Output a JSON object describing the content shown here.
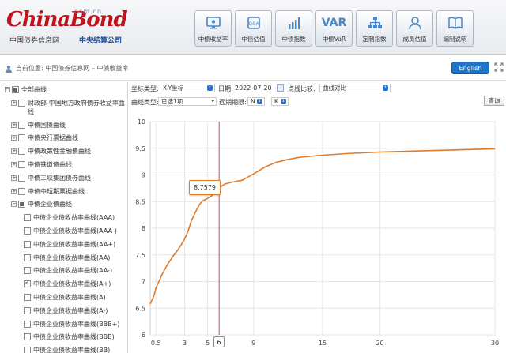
{
  "header": {
    "logo_main": "ChinaBond",
    "logo_domain": "com.cn",
    "logo_sub_cn": "中国债券信息网",
    "logo_sub_right": "中央结算公司",
    "nav": [
      {
        "label": "中债收益率",
        "icon": "monitor-icon"
      },
      {
        "label": "中债估值",
        "icon": "qa-icon"
      },
      {
        "label": "中债指数",
        "icon": "bar-chart-icon"
      },
      {
        "label": "中债VaR",
        "icon": "var-icon",
        "text": "VAR"
      },
      {
        "label": "定制指数",
        "icon": "hierarchy-icon"
      },
      {
        "label": "成员估值",
        "icon": "user-icon"
      },
      {
        "label": "编制说明",
        "icon": "book-icon"
      }
    ]
  },
  "breadcrumb": {
    "text": "当前位置:  中国债券信息网 – 中债收益率"
  },
  "english_button": "English",
  "tree": {
    "items": [
      {
        "label": "全部曲线",
        "toggle": "⊟",
        "check": "partial",
        "level": 0
      },
      {
        "label": "财政部-中国地方政府债券收益率曲线",
        "toggle": "⊞",
        "check": "",
        "level": 1
      },
      {
        "label": "中债国债曲线",
        "toggle": "⊞",
        "check": "",
        "level": 1
      },
      {
        "label": "中债央行票据曲线",
        "toggle": "⊞",
        "check": "",
        "level": 1
      },
      {
        "label": "中债政策性金融债曲线",
        "toggle": "⊞",
        "check": "",
        "level": 1
      },
      {
        "label": "中债铁道债曲线",
        "toggle": "⊞",
        "check": "",
        "level": 1
      },
      {
        "label": "中债三峡集团债券曲线",
        "toggle": "⊞",
        "check": "",
        "level": 1
      },
      {
        "label": "中债中短期票据曲线",
        "toggle": "⊞",
        "check": "",
        "level": 1
      },
      {
        "label": "中债企业债曲线",
        "toggle": "⊟",
        "check": "partial",
        "level": 1
      },
      {
        "label": "中债企业债收益率曲线(AAA)",
        "toggle": "",
        "check": "",
        "level": 2
      },
      {
        "label": "中债企业债收益率曲线(AAA-)",
        "toggle": "",
        "check": "",
        "level": 2
      },
      {
        "label": "中债企业债收益率曲线(AA+)",
        "toggle": "",
        "check": "",
        "level": 2
      },
      {
        "label": "中债企业债收益率曲线(AA)",
        "toggle": "",
        "check": "",
        "level": 2
      },
      {
        "label": "中债企业债收益率曲线(AA-)",
        "toggle": "",
        "check": "",
        "level": 2
      },
      {
        "label": "中债企业债收益率曲线(A+)",
        "toggle": "",
        "check": "checked",
        "level": 2
      },
      {
        "label": "中债企业债收益率曲线(A)",
        "toggle": "",
        "check": "",
        "level": 2
      },
      {
        "label": "中债企业债收益率曲线(A-)",
        "toggle": "",
        "check": "",
        "level": 2
      },
      {
        "label": "中债企业债收益率曲线(BBB+)",
        "toggle": "",
        "check": "",
        "level": 2
      },
      {
        "label": "中债企业债收益率曲线(BBB)",
        "toggle": "",
        "check": "",
        "level": 2
      },
      {
        "label": "中债企业债收益率曲线(BB)",
        "toggle": "",
        "check": "",
        "level": 2
      }
    ]
  },
  "toolbar": {
    "axis_type_label": "坐标类型:",
    "axis_type_value": "X-Y坐标",
    "date_label": "日期:",
    "date_value": "2022-07-20",
    "compare_label": "点线比较:",
    "compare_value": "曲线对比",
    "curve_type_label": "曲线类型:",
    "curve_type_value": "已选1项",
    "forward_label": "远期期限:",
    "forward_n_value": "N",
    "forward_k_value": "K",
    "query_button": "查询"
  },
  "chart_data": {
    "type": "line",
    "title": "",
    "xlabel": "",
    "ylabel": "",
    "xlim": [
      0,
      30
    ],
    "ylim": [
      6,
      10
    ],
    "x_ticks": [
      0.5,
      3,
      5,
      6,
      9,
      15,
      20,
      30
    ],
    "x_tick_labels": [
      "0.5",
      "3",
      "5",
      "6",
      "9",
      "15",
      "20",
      "30"
    ],
    "y_ticks": [
      6,
      6.5,
      7,
      7.5,
      8,
      8.5,
      9,
      9.5,
      10
    ],
    "y_tick_labels": [
      "6",
      "6.5",
      "7",
      "7.5",
      "8",
      "8.5",
      "9",
      "9.5",
      "10"
    ],
    "grid": true,
    "series": [
      {
        "color": "#e07b2a",
        "x": [
          0,
          0.3,
          0.5,
          0.8,
          1,
          1.5,
          2,
          2.5,
          3,
          3.3,
          3.6,
          4,
          4.3,
          4.6,
          5,
          5.3,
          5.6,
          6,
          6.5,
          7,
          8,
          9,
          10,
          11,
          12,
          13,
          15,
          17,
          20,
          25,
          30
        ],
        "y": [
          6.58,
          6.72,
          6.88,
          7.02,
          7.12,
          7.32,
          7.48,
          7.62,
          7.8,
          7.95,
          8.15,
          8.33,
          8.45,
          8.52,
          8.56,
          8.6,
          8.68,
          8.7579,
          8.83,
          8.86,
          8.9,
          9.02,
          9.15,
          9.24,
          9.29,
          9.33,
          9.37,
          9.4,
          9.43,
          9.46,
          9.49
        ]
      }
    ],
    "highlight": {
      "x": 6,
      "y": 8.7579,
      "label": "8.7579",
      "x_label": "6",
      "line_color": "#d9534f"
    }
  }
}
